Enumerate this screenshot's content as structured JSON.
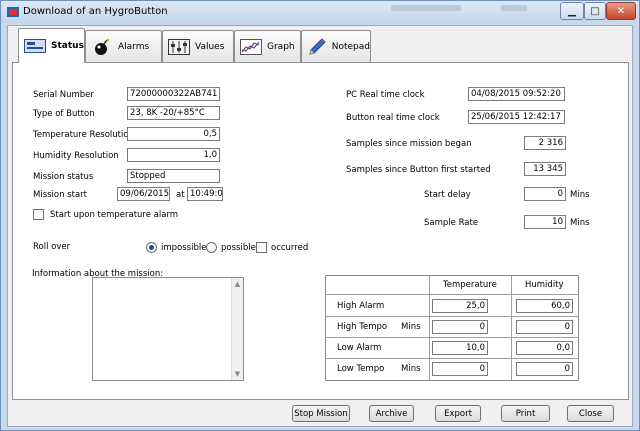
{
  "window": {
    "title": "Download of an HygroButton"
  },
  "tabs": [
    {
      "label": "Status",
      "icon": "status-icon"
    },
    {
      "label": "Alarms",
      "icon": "bomb-icon"
    },
    {
      "label": "Values",
      "icon": "values-icon"
    },
    {
      "label": "Graph",
      "icon": "graph-icon"
    },
    {
      "label": "Notepad",
      "icon": "pencil-icon"
    }
  ],
  "left": {
    "serial_label": "Serial Number",
    "serial_value": "72000000322AB741",
    "type_label": "Type of Button",
    "type_value": "23, 8K -20/+85°C",
    "temp_res_label": "Temperature Resolution",
    "temp_res_value": "0,5",
    "hum_res_label": "Humidity Resolution",
    "hum_res_value": "1,0",
    "mission_status_label": "Mission status",
    "mission_status_value": "Stopped",
    "mission_start_label": "Mission start",
    "mission_start_date": "09/06/2015",
    "at_label": "at",
    "mission_start_time": "10:49:01",
    "alarm_start_label": "Start upon temperature alarm"
  },
  "right": {
    "pc_clock_label": "PC Real time clock",
    "pc_clock_value": "04/08/2015 09:52:20",
    "button_clock_label": "Button real time clock",
    "button_clock_value": "25/06/2015 12:42:17",
    "samples_mission_label": "Samples since mission began",
    "samples_mission_value": "2 316",
    "samples_first_label": "Samples since Button first started",
    "samples_first_value": "13 345",
    "start_delay_label": "Start delay",
    "start_delay_value": "0",
    "start_delay_unit": "Mins",
    "sample_rate_label": "Sample Rate",
    "sample_rate_value": "10",
    "sample_rate_unit": "Mins"
  },
  "rollover": {
    "label": "Roll over",
    "opt1": "impossible",
    "opt2": "possible",
    "opt3": "occurred",
    "selected": "impossible"
  },
  "info": {
    "label": "Information about the mission:"
  },
  "alarms_table": {
    "col_temp": "Temperature",
    "col_hum": "Humidity",
    "rows": [
      {
        "label": "High Alarm",
        "unit": "",
        "temp": "25,0",
        "hum": "60,0"
      },
      {
        "label": "High Tempo",
        "unit": "Mins",
        "temp": "0",
        "hum": "0"
      },
      {
        "label": "Low Alarm",
        "unit": "",
        "temp": "10,0",
        "hum": "0,0"
      },
      {
        "label": "Low Tempo",
        "unit": "Mins",
        "temp": "0",
        "hum": "0"
      }
    ]
  },
  "buttons": {
    "stop": "Stop Mission",
    "archive": "Archive",
    "export": "Export",
    "print": "Print",
    "close": "Close"
  }
}
